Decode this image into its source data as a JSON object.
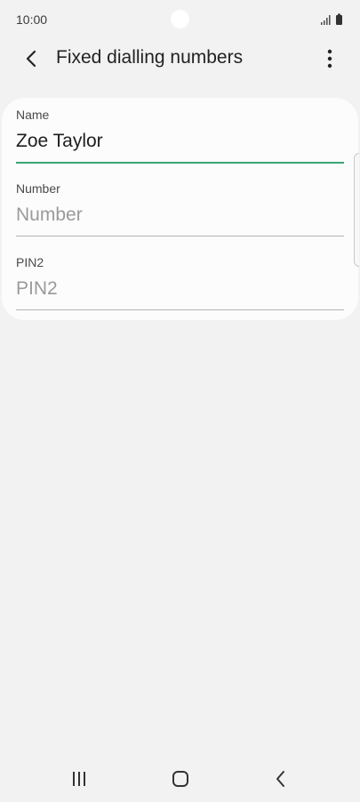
{
  "status_bar": {
    "time": "10:00",
    "icons": [
      "signal-icon",
      "battery-icon"
    ]
  },
  "app_bar": {
    "title": "Fixed dialling numbers",
    "back_icon": "chevron-left-icon",
    "more_icon": "more-vertical-icon"
  },
  "form": {
    "fields": [
      {
        "label": "Name",
        "value": "Zoe Taylor",
        "placeholder": ""
      },
      {
        "label": "Number",
        "value": "",
        "placeholder": "Number"
      },
      {
        "label": "PIN2",
        "value": "",
        "placeholder": "PIN2"
      }
    ]
  },
  "nav_bar": {
    "icons": [
      "recents-icon",
      "home-icon",
      "back-icon"
    ]
  },
  "colors": {
    "background": "#f2f2f2",
    "card": "#fcfcfc",
    "accent": "#3aa576"
  }
}
